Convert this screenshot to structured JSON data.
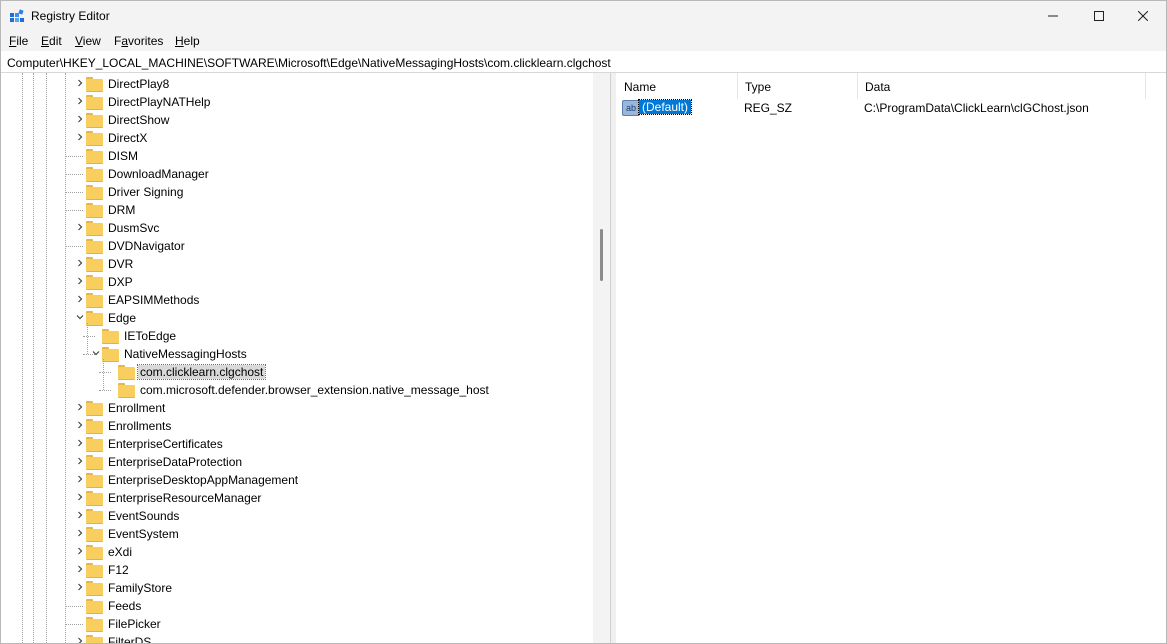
{
  "window": {
    "title": "Registry Editor"
  },
  "menu": [
    "File",
    "Edit",
    "View",
    "Favorites",
    "Help"
  ],
  "menu_underline": [
    "F",
    "E",
    "V",
    "a",
    "H"
  ],
  "address": "Computer\\HKEY_LOCAL_MACHINE\\SOFTWARE\\Microsoft\\Edge\\NativeMessagingHosts\\com.clicklearn.clgchost",
  "tree": {
    "items": [
      {
        "label": "DirectPlay8",
        "level": 0,
        "expander": "collapsed"
      },
      {
        "label": "DirectPlayNATHelp",
        "level": 0,
        "expander": "collapsed"
      },
      {
        "label": "DirectShow",
        "level": 0,
        "expander": "collapsed"
      },
      {
        "label": "DirectX",
        "level": 0,
        "expander": "collapsed"
      },
      {
        "label": "DISM",
        "level": 0,
        "expander": "none"
      },
      {
        "label": "DownloadManager",
        "level": 0,
        "expander": "none"
      },
      {
        "label": "Driver Signing",
        "level": 0,
        "expander": "none"
      },
      {
        "label": "DRM",
        "level": 0,
        "expander": "none"
      },
      {
        "label": "DusmSvc",
        "level": 0,
        "expander": "collapsed"
      },
      {
        "label": "DVDNavigator",
        "level": 0,
        "expander": "none"
      },
      {
        "label": "DVR",
        "level": 0,
        "expander": "collapsed"
      },
      {
        "label": "DXP",
        "level": 0,
        "expander": "collapsed"
      },
      {
        "label": "EAPSIMMethods",
        "level": 0,
        "expander": "collapsed"
      },
      {
        "label": "Edge",
        "level": 0,
        "expander": "expanded"
      },
      {
        "label": "IEToEdge",
        "level": 1,
        "expander": "none"
      },
      {
        "label": "NativeMessagingHosts",
        "level": 1,
        "expander": "expanded"
      },
      {
        "label": "com.clicklearn.clgchost",
        "level": 2,
        "expander": "none",
        "selected": true
      },
      {
        "label": "com.microsoft.defender.browser_extension.native_message_host",
        "level": 2,
        "expander": "none"
      },
      {
        "label": "Enrollment",
        "level": 0,
        "expander": "collapsed"
      },
      {
        "label": "Enrollments",
        "level": 0,
        "expander": "collapsed"
      },
      {
        "label": "EnterpriseCertificates",
        "level": 0,
        "expander": "collapsed"
      },
      {
        "label": "EnterpriseDataProtection",
        "level": 0,
        "expander": "collapsed"
      },
      {
        "label": "EnterpriseDesktopAppManagement",
        "level": 0,
        "expander": "collapsed"
      },
      {
        "label": "EnterpriseResourceManager",
        "level": 0,
        "expander": "collapsed"
      },
      {
        "label": "EventSounds",
        "level": 0,
        "expander": "collapsed"
      },
      {
        "label": "EventSystem",
        "level": 0,
        "expander": "collapsed"
      },
      {
        "label": "eXdi",
        "level": 0,
        "expander": "collapsed"
      },
      {
        "label": "F12",
        "level": 0,
        "expander": "collapsed"
      },
      {
        "label": "FamilyStore",
        "level": 0,
        "expander": "collapsed"
      },
      {
        "label": "Feeds",
        "level": 0,
        "expander": "none"
      },
      {
        "label": "FilePicker",
        "level": 0,
        "expander": "none"
      },
      {
        "label": "FilterDS",
        "level": 0,
        "expander": "collapsed"
      }
    ]
  },
  "list": {
    "columns": [
      "Name",
      "Type",
      "Data"
    ],
    "rows": [
      {
        "icon": "ab-string-value-icon",
        "icon_text": "ab",
        "name": "(Default)",
        "type": "REG_SZ",
        "data": "C:\\ProgramData\\ClickLearn\\clGChost.json",
        "selected": true
      }
    ]
  },
  "colors": {
    "selection": "#0078d7",
    "folder": "#f8cf5e",
    "chrome": "#f3f3f3"
  }
}
